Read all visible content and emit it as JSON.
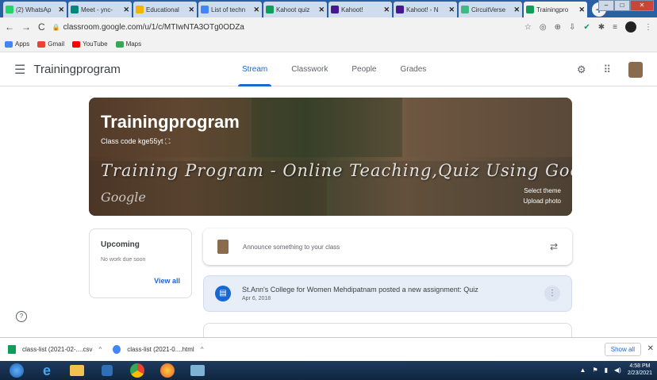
{
  "browser": {
    "tabs": [
      {
        "title": "(2) WhatsAp",
        "color": "#25d366",
        "active": false
      },
      {
        "title": "Meet - ync-",
        "color": "#00897b",
        "active": false
      },
      {
        "title": "Educational",
        "color": "#f4b400",
        "active": false
      },
      {
        "title": "List of techn",
        "color": "#4285f4",
        "active": false
      },
      {
        "title": "Kahoot quiz",
        "color": "#0f9d58",
        "active": false
      },
      {
        "title": "Kahoot!",
        "color": "#46178f",
        "active": false
      },
      {
        "title": "Kahoot! - N",
        "color": "#46178f",
        "active": false
      },
      {
        "title": "CircuitVerse",
        "color": "#42b983",
        "active": false
      },
      {
        "title": "Trainingpro",
        "color": "#0f9d58",
        "active": true
      }
    ],
    "new_tab": "+",
    "url": "classroom.google.com/u/1/c/MTIwNTA3OTg0ODZa",
    "bookmarks": [
      {
        "label": "Apps",
        "color": "#4285f4"
      },
      {
        "label": "Gmail",
        "color": "#ea4335"
      },
      {
        "label": "YouTube",
        "color": "#ff0000"
      },
      {
        "label": "Maps",
        "color": "#34a853"
      }
    ]
  },
  "classroom": {
    "class_name": "Trainingprogram",
    "nav_tabs": [
      "Stream",
      "Classwork",
      "People",
      "Grades"
    ],
    "active_tab": "Stream",
    "banner": {
      "title": "Trainingprogram",
      "class_code": "Class code  kge55yt",
      "script_text": "Training Program - Online Teaching,Quiz Using Google Class Room",
      "script_text2": "Google",
      "select_theme": "Select theme",
      "upload_photo": "Upload photo"
    },
    "upcoming": {
      "title": "Upcoming",
      "subtitle": "No work due soon",
      "link": "View all"
    },
    "announce_placeholder": "Announce something to your class",
    "post": {
      "title": "St.Ann's College for Women Mehdipatnam posted a new assignment: Quiz",
      "date": "Apr 6, 2018"
    }
  },
  "downloads": {
    "items": [
      "class-list (2021-02-....csv",
      "class-list (2021-0....html"
    ],
    "show_all": "Show all"
  },
  "taskbar": {
    "time": "4:58 PM",
    "date": "2/23/2021"
  },
  "colors": {
    "accent": "#1967d2",
    "tabstrip": "#2b5fa3"
  }
}
